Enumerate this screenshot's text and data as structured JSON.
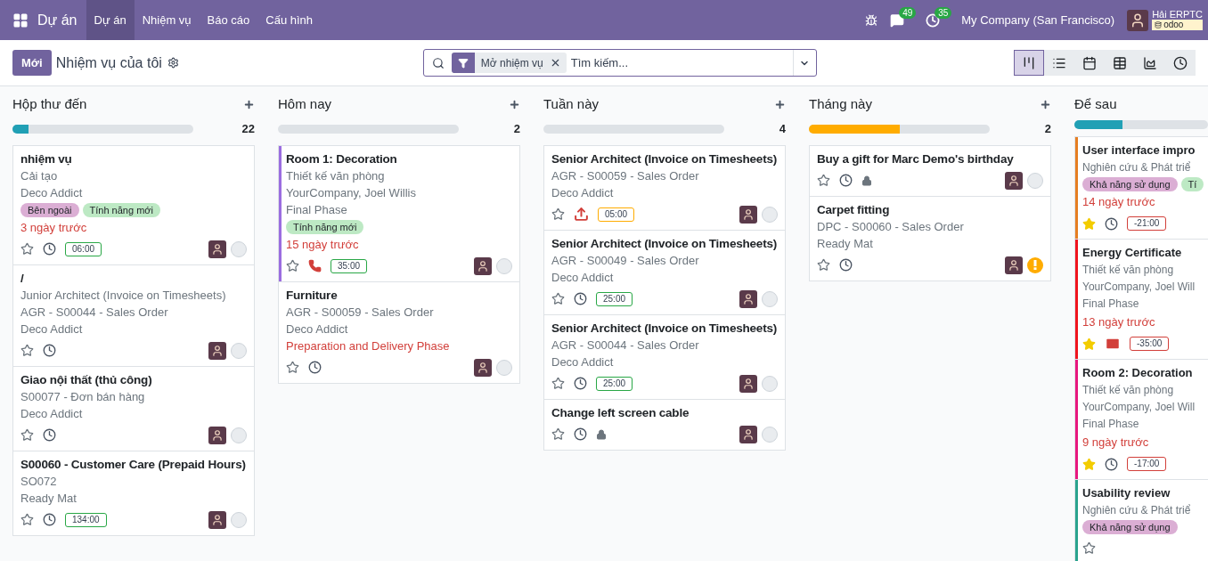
{
  "navbar": {
    "app": "Dự án",
    "menu": [
      {
        "label": "Dự án",
        "selected": true
      },
      {
        "label": "Nhiệm vụ",
        "selected": false
      },
      {
        "label": "Báo cáo",
        "selected": false
      },
      {
        "label": "Cấu hình",
        "selected": false
      }
    ],
    "messages_badge": "49",
    "activities_badge": "35",
    "company": "My Company (San Francisco)",
    "user": "Hải ERPTC",
    "database": "odoo"
  },
  "control_panel": {
    "new_button": "Mới",
    "breadcrumb": "Nhiệm vụ của tôi",
    "facet": "Mở nhiệm vụ",
    "placeholder": "Tìm kiếm...",
    "views": [
      {
        "kind": "kanban",
        "selected": true
      },
      {
        "kind": "list",
        "selected": false
      },
      {
        "kind": "calendar",
        "selected": false
      },
      {
        "kind": "pivot",
        "selected": false
      },
      {
        "kind": "graph",
        "selected": false
      },
      {
        "kind": "activity",
        "selected": false
      }
    ]
  },
  "columns": [
    {
      "title": "Hộp thư đến",
      "count": "22",
      "progress": [
        {
          "color": "#21a0b5",
          "level": 0.09
        }
      ],
      "cards": [
        {
          "title": "nhiệm vụ",
          "lines": [
            {
              "text": "Cải tạo",
              "kind": "muted"
            },
            {
              "text": "Deco Addict",
              "kind": "muted"
            }
          ],
          "tags": [
            {
              "label": "Bên ngoài",
              "color": "#dbaed4"
            },
            {
              "label": "Tính năng mới",
              "color": "#bde9c4"
            }
          ],
          "date": "3 ngày trước",
          "starred": false,
          "activity": {
            "kind": "clock"
          },
          "locked": false,
          "hours": {
            "text": "06:00",
            "kind": "success"
          },
          "assigned": true,
          "blocked": false
        },
        {
          "title": "/",
          "lines": [
            {
              "text": "Junior Architect (Invoice on Timesheets)",
              "kind": "muted"
            },
            {
              "text": "AGR - S00044 - Sales Order",
              "kind": "muted"
            },
            {
              "text": "Deco Addict",
              "kind": "muted"
            }
          ],
          "starred": false,
          "activity": {
            "kind": "clock"
          },
          "locked": false,
          "assigned": true,
          "blocked": false
        },
        {
          "title": "Giao nội thất (thủ công)",
          "lines": [
            {
              "text": "S00077 - Đơn bán hàng",
              "kind": "muted"
            },
            {
              "text": "Deco Addict",
              "kind": "muted"
            }
          ],
          "starred": false,
          "activity": {
            "kind": "clock"
          },
          "locked": false,
          "assigned": true,
          "blocked": false
        },
        {
          "title": "S00060 - Customer Care (Prepaid Hours)",
          "lines": [
            {
              "text": "SO072",
              "kind": "muted"
            },
            {
              "text": "Ready Mat",
              "kind": "muted"
            }
          ],
          "starred": false,
          "activity": {
            "kind": "clock"
          },
          "locked": false,
          "hours": {
            "text": "134:00",
            "kind": "success"
          },
          "assigned": true,
          "blocked": false
        }
      ]
    },
    {
      "title": "Hôm nay",
      "count": "2",
      "progress": [
        {
          "level": 0
        }
      ],
      "cards": [
        {
          "title": "Room 1: Decoration",
          "color": "#9b6de0",
          "lines": [
            {
              "text": "Thiết kế văn phòng",
              "kind": "muted"
            },
            {
              "text": "YourCompany, Joel Willis",
              "kind": "muted"
            },
            {
              "text": "Final Phase",
              "kind": "muted"
            }
          ],
          "tags": [
            {
              "label": "Tính năng mới",
              "color": "#bde9c4"
            }
          ],
          "date": "15 ngày trước",
          "starred": false,
          "activity": {
            "kind": "phone"
          },
          "locked": false,
          "hours": {
            "text": "35:00",
            "kind": "success"
          },
          "assigned": true,
          "blocked": false
        },
        {
          "title": "Furniture",
          "lines": [
            {
              "text": "AGR - S00059 - Sales Order",
              "kind": "muted"
            },
            {
              "text": "Deco Addict",
              "kind": "muted"
            },
            {
              "text": "Preparation and Delivery Phase",
              "kind": "danger"
            }
          ],
          "starred": false,
          "activity": {
            "kind": "clock"
          },
          "locked": false,
          "assigned": true,
          "blocked": false
        }
      ]
    },
    {
      "title": "Tuần này",
      "count": "4",
      "progress": [
        {
          "level": 0
        }
      ],
      "cards": [
        {
          "title": "Senior Architect (Invoice on Timesheets)",
          "lines": [
            {
              "text": "AGR - S00059 - Sales Order",
              "kind": "muted"
            },
            {
              "text": "Deco Addict",
              "kind": "muted"
            }
          ],
          "starred": false,
          "activity": {
            "kind": "upload"
          },
          "locked": false,
          "hours": {
            "text": "05:00",
            "kind": "warning"
          },
          "assigned": true,
          "blocked": false
        },
        {
          "title": "Senior Architect (Invoice on Timesheets)",
          "lines": [
            {
              "text": "AGR - S00049 - Sales Order",
              "kind": "muted"
            },
            {
              "text": "Deco Addict",
              "kind": "muted"
            }
          ],
          "starred": false,
          "activity": {
            "kind": "clock"
          },
          "locked": false,
          "hours": {
            "text": "25:00",
            "kind": "success"
          },
          "assigned": true,
          "blocked": false
        },
        {
          "title": "Senior Architect (Invoice on Timesheets)",
          "lines": [
            {
              "text": "AGR - S00044 - Sales Order",
              "kind": "muted"
            },
            {
              "text": "Deco Addict",
              "kind": "muted"
            }
          ],
          "starred": false,
          "activity": {
            "kind": "clock"
          },
          "locked": false,
          "hours": {
            "text": "25:00",
            "kind": "success"
          },
          "assigned": true,
          "blocked": false
        },
        {
          "title": "Change left screen cable",
          "starred": false,
          "activity": {
            "kind": "clock"
          },
          "locked": true,
          "assigned": true,
          "blocked": false
        }
      ]
    },
    {
      "title": "Tháng này",
      "count": "2",
      "progress": [
        {
          "color": "#ffac00",
          "level": 0.5
        }
      ],
      "cards": [
        {
          "title": "Buy a gift for Marc Demo's birthday",
          "starred": false,
          "activity": {
            "kind": "clock"
          },
          "locked": true,
          "assigned": true,
          "blocked": false
        },
        {
          "title": "Carpet fitting",
          "lines": [
            {
              "text": "DPC - S00060 - Sales Order",
              "kind": "muted"
            },
            {
              "text": "Ready Mat",
              "kind": "muted"
            }
          ],
          "starred": false,
          "activity": {
            "kind": "clock"
          },
          "locked": false,
          "assigned": true,
          "blocked": true
        }
      ]
    },
    {
      "title": "Để sau",
      "progress": [
        {
          "color": "#21a0b5",
          "level": 0.36
        }
      ],
      "cards": [
        {
          "title": "User interface impro",
          "color": "#e67e22",
          "lines": [
            {
              "text": "Nghiên cứu & Phát triể",
              "kind": "muted"
            }
          ],
          "tags": [
            {
              "label": "Khả năng sử dụng",
              "color": "#dbaed4"
            },
            {
              "label": "Tí",
              "color": "#bde9c4"
            }
          ],
          "date": "14 ngày trước",
          "starred": true,
          "activity": {
            "kind": "clock"
          },
          "locked": false,
          "hours": {
            "text": "-21:00",
            "kind": "danger"
          }
        },
        {
          "title": "Energy Certificate",
          "color": "#f0141e",
          "lines": [
            {
              "text": "Thiết kế văn phòng",
              "kind": "muted"
            },
            {
              "text": "YourCompany, Joel Will",
              "kind": "muted"
            },
            {
              "text": "Final Phase",
              "kind": "muted"
            }
          ],
          "date": "13 ngày trước",
          "starred": true,
          "activity": {
            "kind": "mail"
          },
          "locked": false,
          "hours": {
            "text": "-35:00",
            "kind": "danger"
          }
        },
        {
          "title": "Room 2: Decoration",
          "color": "#e8177e",
          "lines": [
            {
              "text": "Thiết kế văn phòng",
              "kind": "muted"
            },
            {
              "text": "YourCompany, Joel Will",
              "kind": "muted"
            },
            {
              "text": "Final Phase",
              "kind": "muted"
            }
          ],
          "date": "9 ngày trước",
          "starred": true,
          "activity": {
            "kind": "clock"
          },
          "locked": false,
          "hours": {
            "text": "-17:00",
            "kind": "danger"
          }
        },
        {
          "title": "Usability review",
          "color": "#2aa38d",
          "lines": [
            {
              "text": "Nghiên cứu & Phát triể",
              "kind": "muted"
            }
          ],
          "tags": [
            {
              "label": "Khả năng sử dụng",
              "color": "#dbaed4"
            }
          ],
          "starred": false,
          "locked": false
        }
      ]
    }
  ]
}
